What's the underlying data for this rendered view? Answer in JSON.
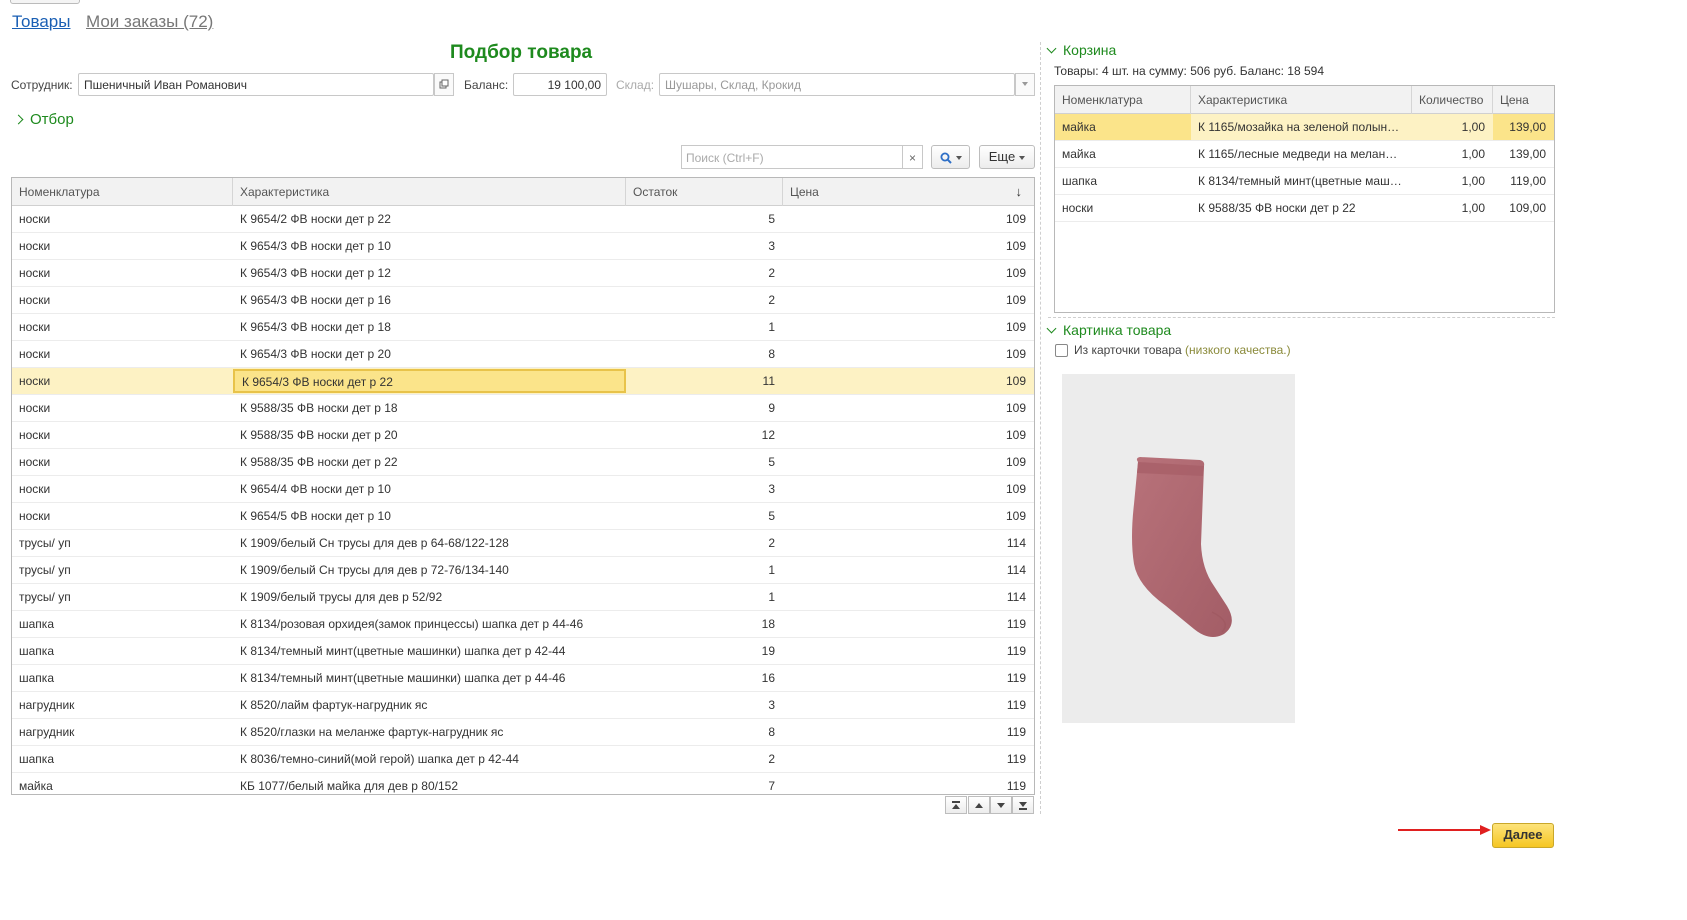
{
  "tabs": {
    "products": "Товары",
    "my_orders": "Мои заказы (72)"
  },
  "page_title": "Подбор товара",
  "employee": {
    "label": "Сотрудник:",
    "value": "Пшеничный Иван Романович"
  },
  "balance": {
    "label": "Баланс:",
    "value": "19 100,00"
  },
  "warehouse": {
    "label": "Склад:",
    "value": "Шушары, Склад, Крокид"
  },
  "filter_section": "Отбор",
  "search": {
    "placeholder": "Поиск (Ctrl+F)",
    "clear": "×"
  },
  "more_button": "Еще",
  "products_table": {
    "columns": [
      "Номенклатура",
      "Характеристика",
      "Остаток",
      "Цена"
    ],
    "sort_indicator": "↓",
    "selected_index": 6,
    "rows": [
      [
        "носки",
        "К 9654/2 ФВ носки дет р 22",
        "5",
        "109"
      ],
      [
        "носки",
        "К 9654/3 ФВ носки дет р 10",
        "3",
        "109"
      ],
      [
        "носки",
        "К 9654/3 ФВ носки дет р 12",
        "2",
        "109"
      ],
      [
        "носки",
        "К 9654/3 ФВ носки дет р 16",
        "2",
        "109"
      ],
      [
        "носки",
        "К 9654/3 ФВ носки дет р 18",
        "1",
        "109"
      ],
      [
        "носки",
        "К 9654/3 ФВ носки дет р 20",
        "8",
        "109"
      ],
      [
        "носки",
        "К 9654/3 ФВ носки дет р 22",
        "11",
        "109"
      ],
      [
        "носки",
        "К 9588/35 ФВ носки дет р 18",
        "9",
        "109"
      ],
      [
        "носки",
        "К 9588/35 ФВ носки дет р 20",
        "12",
        "109"
      ],
      [
        "носки",
        "К 9588/35 ФВ носки дет р 22",
        "5",
        "109"
      ],
      [
        "носки",
        "К 9654/4 ФВ носки дет р 10",
        "3",
        "109"
      ],
      [
        "носки",
        "К 9654/5 ФВ носки дет р 10",
        "5",
        "109"
      ],
      [
        "трусы/ уп",
        "К 1909/белый Сн трусы для дев р 64-68/122-128",
        "2",
        "114"
      ],
      [
        "трусы/ уп",
        "К 1909/белый Сн трусы для дев р 72-76/134-140",
        "1",
        "114"
      ],
      [
        "трусы/ уп",
        "К 1909/белый трусы для дев р 52/92",
        "1",
        "114"
      ],
      [
        "шапка",
        "К 8134/розовая орхидея(замок принцессы) шапка дет р 44-46",
        "18",
        "119"
      ],
      [
        "шапка",
        "К 8134/темный минт(цветные машинки) шапка дет р 42-44",
        "19",
        "119"
      ],
      [
        "шапка",
        "К 8134/темный минт(цветные машинки) шапка дет р 44-46",
        "16",
        "119"
      ],
      [
        "нагрудник",
        "К 8520/лайм фартук-нагрудник яс",
        "3",
        "119"
      ],
      [
        "нагрудник",
        "К 8520/глазки на меланже фартук-нагрудник яс",
        "8",
        "119"
      ],
      [
        "шапка",
        "К 8036/темно-синий(мой герой) шапка дет р 42-44",
        "2",
        "119"
      ],
      [
        "майка",
        "КБ 1077/белый майка для дев р 80/152",
        "7",
        "119"
      ]
    ]
  },
  "cart": {
    "title": "Корзина",
    "summary": "Товары: 4 шт. на сумму: 506 руб. Баланс: 18 594",
    "columns": [
      "Номенклатура",
      "Характеристика",
      "Количество",
      "Цена"
    ],
    "selected_index": 0,
    "rows": [
      [
        "майка",
        "К 1165/мозайка на зеленой полын…",
        "1,00",
        "139,00"
      ],
      [
        "майка",
        "К 1165/лесные медведи на мелан…",
        "1,00",
        "139,00"
      ],
      [
        "шапка",
        "К 8134/темный минт(цветные маш…",
        "1,00",
        "119,00"
      ],
      [
        "носки",
        "К 9588/35 ФВ носки дет р 22",
        "1,00",
        "109,00"
      ]
    ]
  },
  "picture": {
    "title": "Картинка товара",
    "checkbox_label": "Из карточки товара",
    "checkbox_note": "(низкого качества.)",
    "checked": false,
    "image_subject": "sock-photo"
  },
  "next_button": "Далее",
  "colors": {
    "accent_green": "#1e8a1e",
    "link_blue": "#1a5fb4",
    "selected_row": "#fdf2c4",
    "focus_cell": "#fbe48a",
    "next_button": "#f5c623",
    "arrow_red": "#e02020",
    "sock": "#b5686f"
  },
  "icons": {
    "open_field": "open-window-icon",
    "dropdown": "chevron-down-icon",
    "search": "magnifier-icon",
    "nav": [
      "first-page-icon",
      "page-up-icon",
      "page-down-icon",
      "last-page-icon"
    ]
  }
}
